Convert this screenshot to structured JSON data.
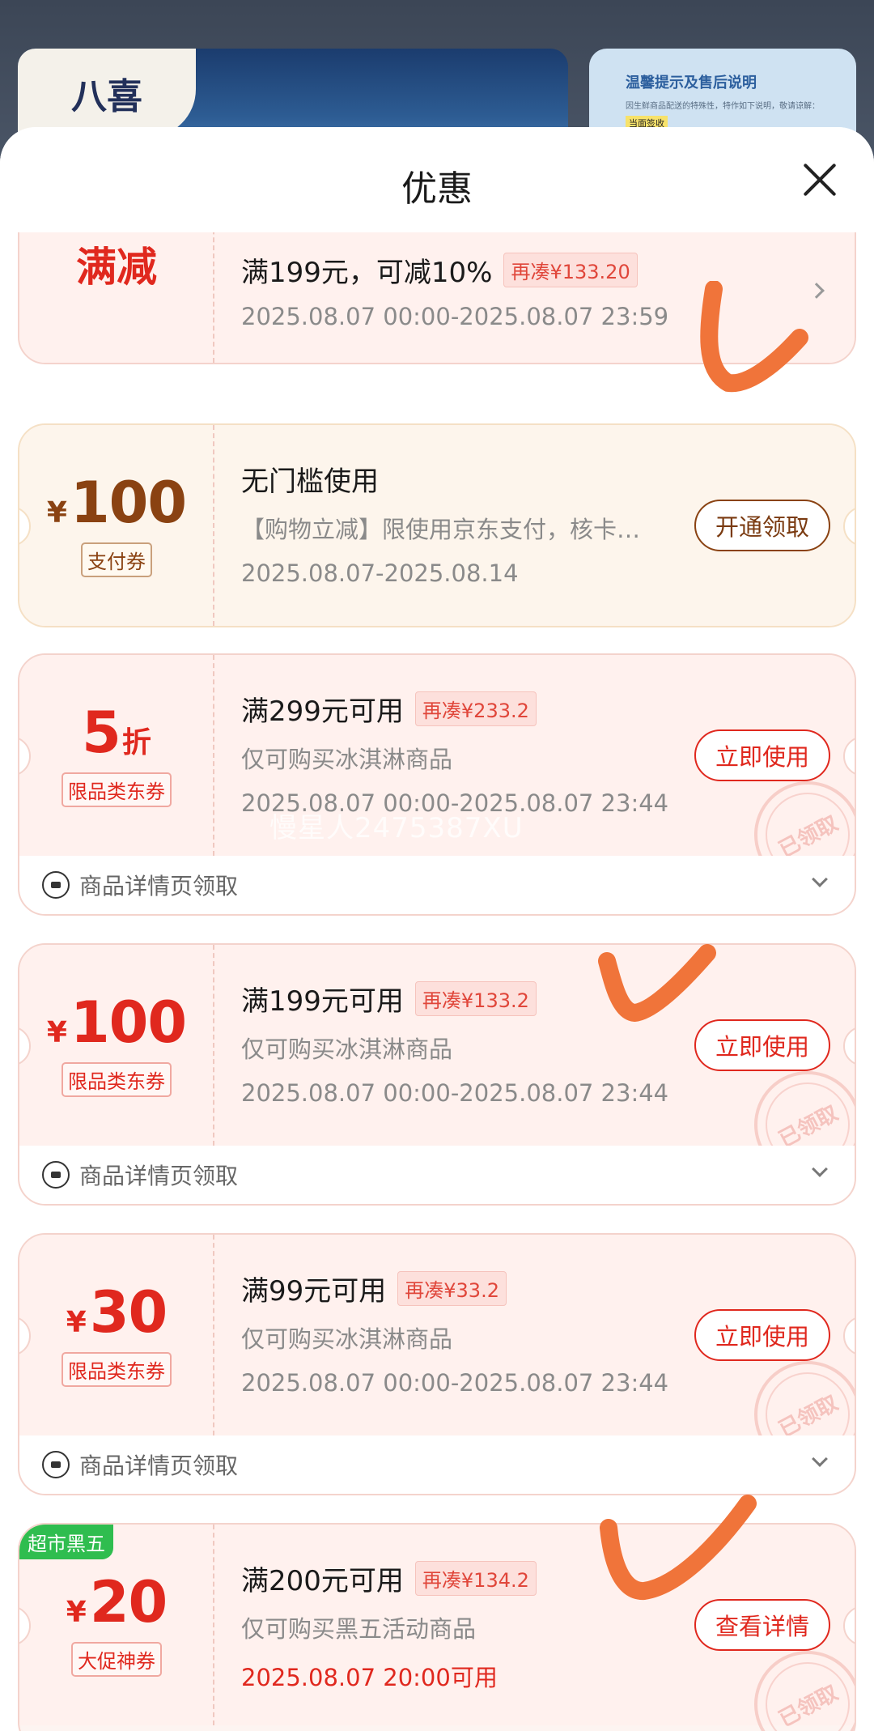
{
  "background": {
    "logo_text": "八喜",
    "notice_title": "温馨提示及售后说明",
    "notice_body": "因生鲜商品配送的特殊性，特作如下说明，敬请谅解：",
    "notice_highlight": "当面签收"
  },
  "sheet": {
    "title": "优惠"
  },
  "coupons": [
    {
      "left_label": "满减",
      "main": "满199元，可减10%",
      "pill": "再凑¥133.20",
      "date": "2025.08.07 00:00-2025.08.07 23:59"
    },
    {
      "yen": "¥",
      "amount": "100",
      "tag": "支付券",
      "main": "无门槛使用",
      "desc": "【购物立减】限使用京东支付，核卡…",
      "date": "2025.08.07-2025.08.14",
      "button": "开通领取"
    },
    {
      "amount": "5",
      "unit": "折",
      "tag": "限品类东券",
      "main": "满299元可用",
      "pill": "再凑¥233.2",
      "desc": "仅可购买冰淇淋商品",
      "date": "2025.08.07 00:00-2025.08.07 23:44",
      "button": "立即使用",
      "stamp": "已领取",
      "footer": "商品详情页领取"
    },
    {
      "yen": "¥",
      "amount": "100",
      "tag": "限品类东券",
      "main": "满199元可用",
      "pill": "再凑¥133.2",
      "desc": "仅可购买冰淇淋商品",
      "date": "2025.08.07 00:00-2025.08.07 23:44",
      "button": "立即使用",
      "stamp": "已领取",
      "footer": "商品详情页领取"
    },
    {
      "yen": "¥",
      "amount": "30",
      "tag": "限品类东券",
      "main": "满99元可用",
      "pill": "再凑¥33.2",
      "desc": "仅可购买冰淇淋商品",
      "date": "2025.08.07 00:00-2025.08.07 23:44",
      "button": "立即使用",
      "stamp": "已领取",
      "footer": "商品详情页领取"
    },
    {
      "badge": "超市黑五",
      "yen": "¥",
      "amount": "20",
      "tag": "大促神券",
      "main": "满200元可用",
      "pill": "再凑¥134.2",
      "desc": "仅可购买黑五活动商品",
      "date": "2025.08.07 20:00可用",
      "button": "查看详情",
      "stamp": "已领取"
    }
  ],
  "watermark": "慢星人2475387XU",
  "colors": {
    "accent_red": "#e0281e",
    "gold_brown": "#8a4212",
    "promo_green": "#2fbd4f",
    "check_orange": "#f0743a"
  }
}
